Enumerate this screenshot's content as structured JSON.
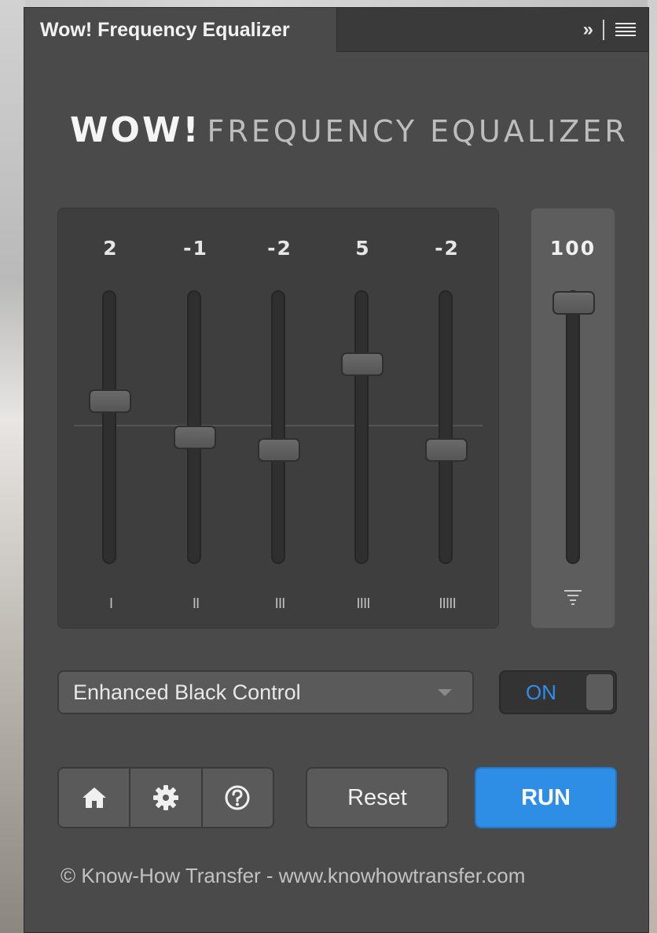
{
  "panel": {
    "tab_title": "Wow! Frequency Equalizer",
    "collapse_glyph": "»",
    "heading_bold": "WOW!",
    "heading_light": "FREQUENCY EQUALIZER"
  },
  "bands": [
    {
      "value": "2",
      "mark": "I"
    },
    {
      "value": "-1",
      "mark": "II"
    },
    {
      "value": "-2",
      "mark": "III"
    },
    {
      "value": "5",
      "mark": "IIII"
    },
    {
      "value": "-2",
      "mark": "IIIII"
    }
  ],
  "master": {
    "value": "100"
  },
  "preset": {
    "selected": "Enhanced Black Control"
  },
  "toggle": {
    "label": "ON"
  },
  "buttons": {
    "reset": "Reset",
    "run": "RUN"
  },
  "footer": {
    "text": "© Know-How Transfer - www.knowhowtransfer.com"
  },
  "colors": {
    "accent": "#2e8ee6",
    "panel_bg": "#4a4a4a"
  }
}
